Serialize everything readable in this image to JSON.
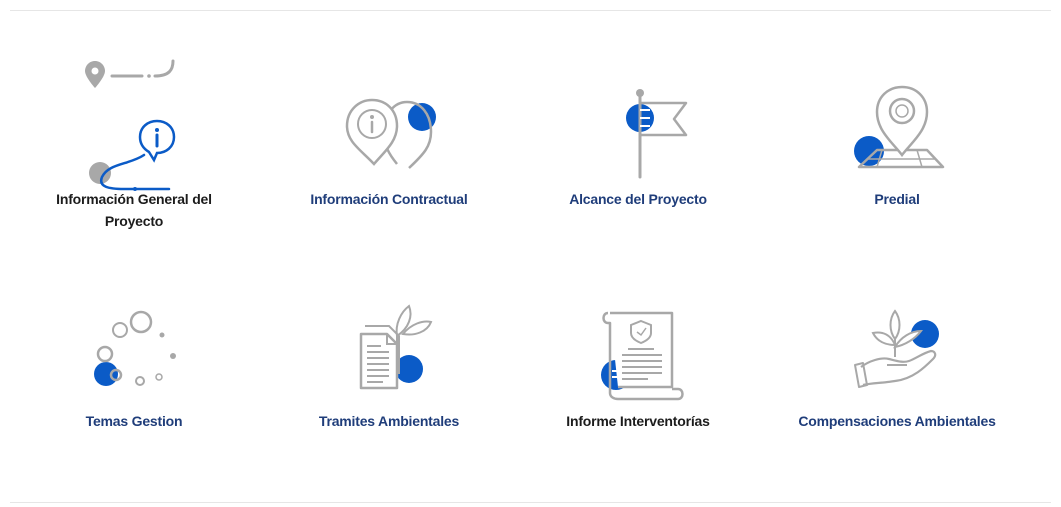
{
  "colors": {
    "accent": "#0b5bc7",
    "icon_gray": "#a8a8a8",
    "label_navy": "#1f3d7a",
    "label_dark": "#1c1c1c"
  },
  "tiles": [
    {
      "label": "Información General del Proyecto",
      "icon": "route-info-icon"
    },
    {
      "label": "Información Contractual",
      "icon": "info-pins-icon"
    },
    {
      "label": "Alcance del Proyecto",
      "icon": "flag-icon"
    },
    {
      "label": "Predial",
      "icon": "map-pin-icon"
    },
    {
      "label": "Temas Gestion",
      "icon": "loading-dots-icon"
    },
    {
      "label": "Tramites Ambientales",
      "icon": "document-leaf-icon"
    },
    {
      "label": "Informe Interventorías",
      "icon": "certificate-scroll-icon"
    },
    {
      "label": "Compensaciones Ambientales",
      "icon": "hand-plant-icon"
    }
  ]
}
